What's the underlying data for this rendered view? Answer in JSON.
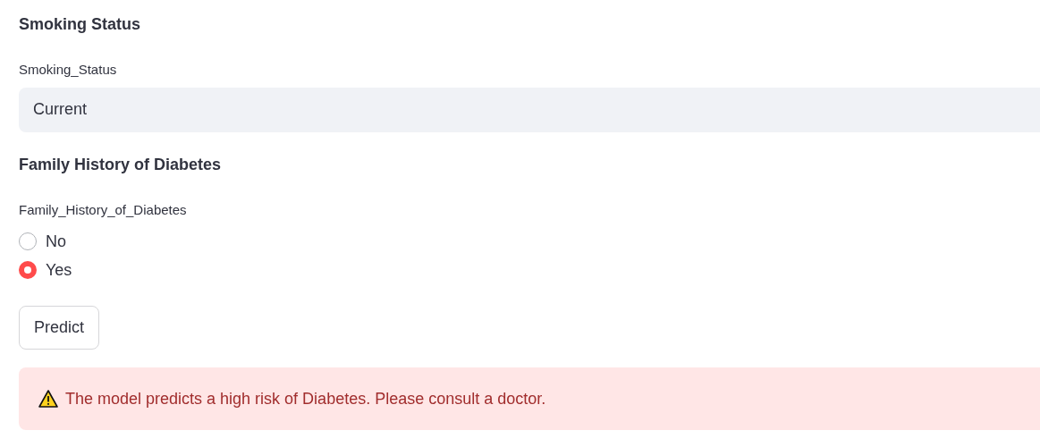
{
  "sections": [
    {
      "heading": "Smoking Status",
      "kind": "select",
      "label": "Smoking_Status",
      "value": "Current"
    },
    {
      "heading": "Family History of Diabetes",
      "kind": "radio",
      "label": "Family_History_of_Diabetes",
      "options": [
        {
          "label": "No",
          "selected": false
        },
        {
          "label": "Yes",
          "selected": true
        }
      ]
    }
  ],
  "button": {
    "label": "Predict"
  },
  "alert": {
    "kind": "error",
    "text": "The model predicts a high risk of Diabetes. Please consult a doctor."
  }
}
